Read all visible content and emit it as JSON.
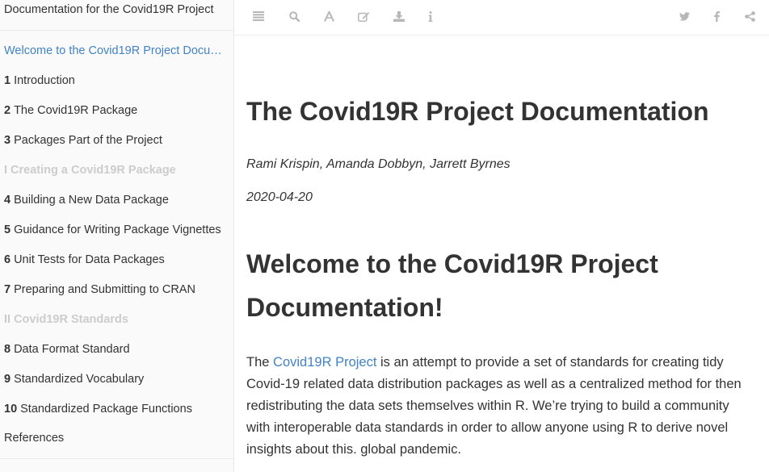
{
  "sidebar": {
    "book_title": "Documentation for the Covid19R Project",
    "active_item": "Welcome to the Covid19R Project Documentation!",
    "items": [
      {
        "num": "1",
        "label": "Introduction"
      },
      {
        "num": "2",
        "label": "The Covid19R Package"
      },
      {
        "num": "3",
        "label": "Packages Part of the Project"
      },
      {
        "num": "4",
        "label": "Building a New Data Package"
      },
      {
        "num": "5",
        "label": "Guidance for Writing Package Vignettes"
      },
      {
        "num": "6",
        "label": "Unit Tests for Data Packages"
      },
      {
        "num": "7",
        "label": "Preparing and Submitting to CRAN"
      },
      {
        "num": "8",
        "label": "Data Format Standard"
      },
      {
        "num": "9",
        "label": "Standardized Vocabulary"
      },
      {
        "num": "10",
        "label": "Standardized Package Functions"
      }
    ],
    "parts": [
      "I Creating a Covid19R Package",
      "II Covid19R Standards"
    ],
    "references": "References"
  },
  "toolbar": {
    "icons": [
      "menu-icon",
      "search-icon",
      "font-icon",
      "edit-icon",
      "download-icon",
      "info-icon",
      "twitter-icon",
      "facebook-icon",
      "share-icon"
    ],
    "icon_color": "#b7b7b7"
  },
  "main": {
    "title": "The Covid19R Project Documentation",
    "authors": "Rami Krispin, Amanda Dobbyn, Jarrett Byrnes",
    "date": "2020-04-20",
    "heading": "Welcome to the Covid19R Project Documentation!",
    "intro_before": "The ",
    "intro_link": "Covid19R Project",
    "intro_after": " is an attempt to provide a set of standards for creating tidy Covid-19 related data distribution packages as well as a centralized method for then redistributing the data sets themselves within R. We’re trying to build a community with interoperable data standards in order to allow anyone using R to derive novel insights about this. global pandemic."
  },
  "colors": {
    "link": "#4183c4",
    "part_heading": "#cccccc",
    "text": "#333333"
  }
}
